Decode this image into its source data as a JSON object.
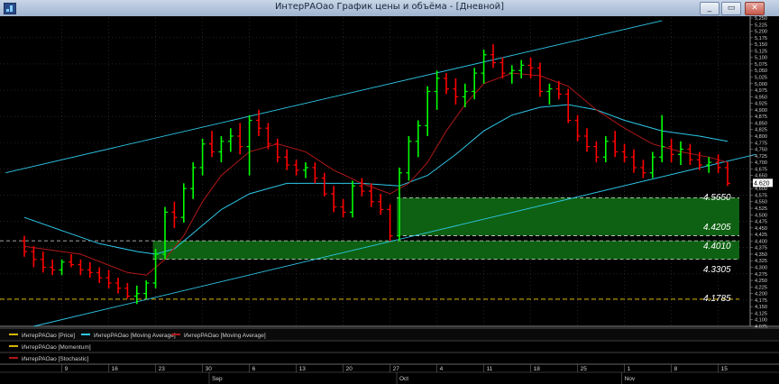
{
  "window": {
    "title": "ИнтерРАОао График цены и объёма - [Дневной]",
    "buttons": {
      "minimize": "_",
      "restore": "▭",
      "close": "✕"
    }
  },
  "legend": {
    "price": "ИнтерРАОао [Price]",
    "ma_fast": "ИнтерРАОао [Moving Average]",
    "ma_slow": "ИнтерРАОао [Moving Average]",
    "momentum": "ИнтерРАОао [Momentum]",
    "stochastic": "ИнтерРАОао [Stochastic]"
  },
  "zone_labels": {
    "z1_top": "4.5650",
    "z1_bottom": "4.4205",
    "z2_top": "4.4010",
    "z2_bottom": "4.3305",
    "support": "4.1785"
  },
  "current_price_label": "4.620",
  "colors": {
    "up": "#00ff00",
    "down": "#ff0000",
    "ma_fast": "#b01818",
    "ma_slow": "#2ec8e8",
    "channel": "#2ec8e8",
    "zone_fill": "#0f6b14",
    "zone_border": "#d8d8d8",
    "support": "#d8b400",
    "grid": "#3a3a3a",
    "axis_text": "#d0d0d0"
  },
  "chart_data": {
    "type": "candlestick",
    "y_axis": {
      "min": 4.075,
      "max": 5.25,
      "tick_step": 0.025,
      "position": "right"
    },
    "x_ticks": [
      {
        "i": 4,
        "label": "9"
      },
      {
        "i": 9,
        "label": "16"
      },
      {
        "i": 14,
        "label": "23"
      },
      {
        "i": 19,
        "label": "30"
      },
      {
        "i": 24,
        "label": "6"
      },
      {
        "i": 29,
        "label": "13"
      },
      {
        "i": 34,
        "label": "20"
      },
      {
        "i": 39,
        "label": "27"
      },
      {
        "i": 44,
        "label": "4"
      },
      {
        "i": 49,
        "label": "11"
      },
      {
        "i": 54,
        "label": "18"
      },
      {
        "i": 59,
        "label": "25"
      },
      {
        "i": 64,
        "label": "1"
      },
      {
        "i": 69,
        "label": "8"
      },
      {
        "i": 74,
        "label": "15"
      }
    ],
    "month_labels": [
      {
        "i": 20,
        "label": "Sep"
      },
      {
        "i": 40,
        "label": "Oct"
      },
      {
        "i": 64,
        "label": "Nov"
      }
    ],
    "candles": [
      [
        4.4,
        4.42,
        4.34,
        4.36
      ],
      [
        4.36,
        4.38,
        4.3,
        4.33
      ],
      [
        4.33,
        4.36,
        4.28,
        4.3
      ],
      [
        4.3,
        4.33,
        4.27,
        4.29
      ],
      [
        4.29,
        4.33,
        4.27,
        4.32
      ],
      [
        4.32,
        4.35,
        4.3,
        4.31
      ],
      [
        4.31,
        4.33,
        4.27,
        4.29
      ],
      [
        4.29,
        4.32,
        4.26,
        4.28
      ],
      [
        4.28,
        4.3,
        4.24,
        4.26
      ],
      [
        4.26,
        4.29,
        4.22,
        4.24
      ],
      [
        4.24,
        4.26,
        4.2,
        4.22
      ],
      [
        4.22,
        4.24,
        4.18,
        4.19
      ],
      [
        4.19,
        4.23,
        4.16,
        4.2
      ],
      [
        4.2,
        4.25,
        4.18,
        4.24
      ],
      [
        4.24,
        4.37,
        4.22,
        4.35
      ],
      [
        4.35,
        4.53,
        4.33,
        4.51
      ],
      [
        4.51,
        4.55,
        4.45,
        4.49
      ],
      [
        4.49,
        4.62,
        4.47,
        4.6
      ],
      [
        4.6,
        4.7,
        4.56,
        4.68
      ],
      [
        4.68,
        4.79,
        4.65,
        4.77
      ],
      [
        4.77,
        4.82,
        4.72,
        4.74
      ],
      [
        4.74,
        4.8,
        4.7,
        4.78
      ],
      [
        4.78,
        4.83,
        4.74,
        4.8
      ],
      [
        4.8,
        4.85,
        4.73,
        4.76
      ],
      [
        4.76,
        4.88,
        4.65,
        4.86
      ],
      [
        4.86,
        4.9,
        4.8,
        4.83
      ],
      [
        4.83,
        4.85,
        4.75,
        4.77
      ],
      [
        4.77,
        4.79,
        4.7,
        4.72
      ],
      [
        4.72,
        4.75,
        4.67,
        4.69
      ],
      [
        4.69,
        4.71,
        4.65,
        4.67
      ],
      [
        4.67,
        4.7,
        4.64,
        4.68
      ],
      [
        4.68,
        4.7,
        4.62,
        4.64
      ],
      [
        4.64,
        4.66,
        4.57,
        4.58
      ],
      [
        4.58,
        4.61,
        4.51,
        4.53
      ],
      [
        4.53,
        4.56,
        4.49,
        4.51
      ],
      [
        4.51,
        4.63,
        4.49,
        4.61
      ],
      [
        4.61,
        4.64,
        4.57,
        4.59
      ],
      [
        4.59,
        4.62,
        4.53,
        4.55
      ],
      [
        4.55,
        4.58,
        4.5,
        4.52
      ],
      [
        4.52,
        4.54,
        4.4,
        4.42
      ],
      [
        4.42,
        4.68,
        4.4,
        4.66
      ],
      [
        4.66,
        4.8,
        4.63,
        4.78
      ],
      [
        4.78,
        4.86,
        4.72,
        4.84
      ],
      [
        4.84,
        4.99,
        4.8,
        4.97
      ],
      [
        4.97,
        5.05,
        4.9,
        5.02
      ],
      [
        5.02,
        5.04,
        4.96,
        4.98
      ],
      [
        4.98,
        5.02,
        4.92,
        4.95
      ],
      [
        4.95,
        5.0,
        4.91,
        4.97
      ],
      [
        4.97,
        5.06,
        4.94,
        5.04
      ],
      [
        5.04,
        5.13,
        5.0,
        5.11
      ],
      [
        5.11,
        5.15,
        5.06,
        5.08
      ],
      [
        5.08,
        5.1,
        5.02,
        5.04
      ],
      [
        5.04,
        5.07,
        5.0,
        5.05
      ],
      [
        5.05,
        5.09,
        5.02,
        5.07
      ],
      [
        5.07,
        5.1,
        5.02,
        5.06
      ],
      [
        5.06,
        5.08,
        4.95,
        4.97
      ],
      [
        4.97,
        5.0,
        4.92,
        4.98
      ],
      [
        4.98,
        5.01,
        4.94,
        4.96
      ],
      [
        4.96,
        4.98,
        4.85,
        4.86
      ],
      [
        4.86,
        4.88,
        4.78,
        4.8
      ],
      [
        4.8,
        4.83,
        4.74,
        4.76
      ],
      [
        4.76,
        4.78,
        4.7,
        4.72
      ],
      [
        4.72,
        4.8,
        4.7,
        4.78
      ],
      [
        4.78,
        4.82,
        4.72,
        4.74
      ],
      [
        4.74,
        4.77,
        4.7,
        4.72
      ],
      [
        4.72,
        4.75,
        4.66,
        4.68
      ],
      [
        4.68,
        4.71,
        4.64,
        4.66
      ],
      [
        4.66,
        4.74,
        4.64,
        4.72
      ],
      [
        4.72,
        4.88,
        4.7,
        4.76
      ],
      [
        4.76,
        4.79,
        4.7,
        4.73
      ],
      [
        4.73,
        4.78,
        4.69,
        4.75
      ],
      [
        4.75,
        4.77,
        4.69,
        4.71
      ],
      [
        4.71,
        4.74,
        4.67,
        4.69
      ],
      [
        4.69,
        4.72,
        4.66,
        4.7
      ],
      [
        4.7,
        4.73,
        4.66,
        4.68
      ],
      [
        4.68,
        4.7,
        4.61,
        4.62
      ]
    ],
    "ma_fast": [
      [
        0,
        4.38
      ],
      [
        6,
        4.35
      ],
      [
        11,
        4.28
      ],
      [
        13,
        4.27
      ],
      [
        15,
        4.33
      ],
      [
        17,
        4.42
      ],
      [
        19,
        4.55
      ],
      [
        21,
        4.65
      ],
      [
        24,
        4.74
      ],
      [
        27,
        4.77
      ],
      [
        30,
        4.74
      ],
      [
        33,
        4.67
      ],
      [
        36,
        4.62
      ],
      [
        39,
        4.58
      ],
      [
        41,
        4.62
      ],
      [
        43,
        4.7
      ],
      [
        45,
        4.82
      ],
      [
        47,
        4.92
      ],
      [
        49,
        5.0
      ],
      [
        52,
        5.04
      ],
      [
        55,
        5.03
      ],
      [
        58,
        4.99
      ],
      [
        61,
        4.9
      ],
      [
        64,
        4.83
      ],
      [
        67,
        4.77
      ],
      [
        70,
        4.74
      ],
      [
        73,
        4.72
      ],
      [
        75,
        4.7
      ]
    ],
    "ma_slow": [
      [
        0,
        4.49
      ],
      [
        4,
        4.44
      ],
      [
        8,
        4.39
      ],
      [
        12,
        4.36
      ],
      [
        14,
        4.35
      ],
      [
        16,
        4.37
      ],
      [
        18,
        4.43
      ],
      [
        21,
        4.52
      ],
      [
        24,
        4.58
      ],
      [
        28,
        4.62
      ],
      [
        32,
        4.62
      ],
      [
        36,
        4.62
      ],
      [
        40,
        4.61
      ],
      [
        43,
        4.65
      ],
      [
        46,
        4.73
      ],
      [
        49,
        4.82
      ],
      [
        52,
        4.88
      ],
      [
        55,
        4.91
      ],
      [
        58,
        4.92
      ],
      [
        61,
        4.9
      ],
      [
        64,
        4.86
      ],
      [
        68,
        4.82
      ],
      [
        72,
        4.8
      ],
      [
        75,
        4.78
      ]
    ],
    "channel_upper": [
      [
        -2,
        4.66
      ],
      [
        68,
        5.24
      ]
    ],
    "channel_lower": [
      [
        1,
        4.075
      ],
      [
        78,
        4.73
      ]
    ],
    "zones": [
      {
        "top": 4.565,
        "bottom": 4.4205,
        "from_i": 40
      },
      {
        "top": 4.401,
        "bottom": 4.3305,
        "from_i": 14
      }
    ],
    "support_level": 4.1785
  }
}
